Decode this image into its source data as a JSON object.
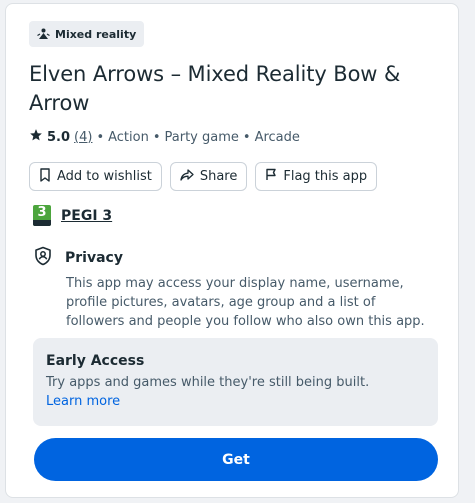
{
  "badge": {
    "icon": "mixed-reality-icon",
    "label": "Mixed reality"
  },
  "app": {
    "title": "Elven Arrows – Mixed Reality Bow & Arrow"
  },
  "rating": {
    "icon": "star-icon",
    "score": "5.0",
    "count": "(4)",
    "separator": "•",
    "genres": [
      "Action",
      "Party game",
      "Arcade"
    ]
  },
  "actions": {
    "wishlist": {
      "icon": "bookmark-icon",
      "label": "Add to wishlist"
    },
    "share": {
      "icon": "share-icon",
      "label": "Share"
    },
    "flag": {
      "icon": "flag-icon",
      "label": "Flag this app"
    }
  },
  "pegi": {
    "badge_number": "3",
    "label": "PEGI 3",
    "color": "#4ca53d"
  },
  "privacy": {
    "icon": "privacy-shield-icon",
    "title": "Privacy",
    "body": "This app may access your display name, username, profile pictures, avatars, age group and a list of followers and people you follow who also own this app."
  },
  "early_access": {
    "title": "Early Access",
    "body": "Try apps and games while they're still being built.",
    "link": "Learn more"
  },
  "get_button": {
    "label": "Get",
    "color": "#0064e0"
  }
}
